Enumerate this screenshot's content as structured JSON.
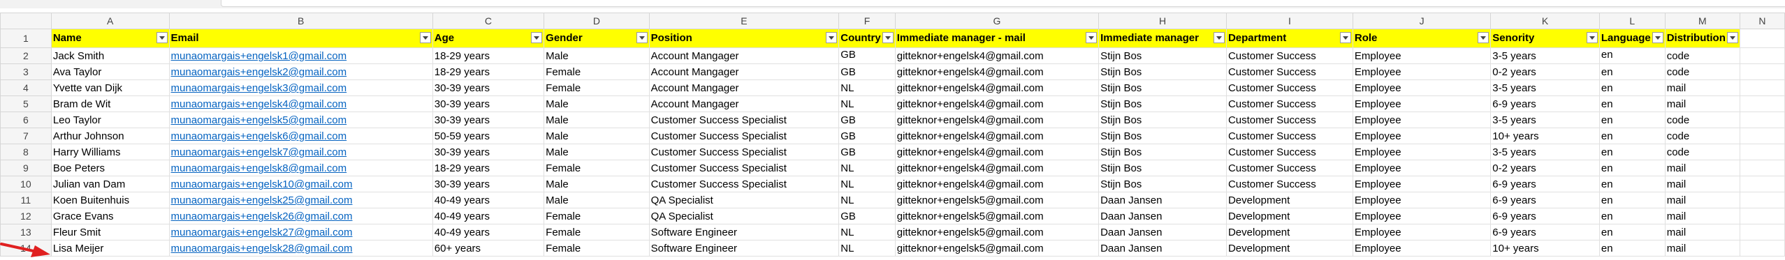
{
  "columns": [
    "A",
    "B",
    "C",
    "D",
    "E",
    "F",
    "G",
    "H",
    "I",
    "J",
    "K",
    "L",
    "M",
    "N"
  ],
  "headers": [
    "Name",
    "Email",
    "Age",
    "Gender",
    "Position",
    "Country",
    "Immediate manager - mail",
    "Immediate manager",
    "Department",
    "Role",
    "Senority",
    "Language",
    "Distribution",
    ""
  ],
  "rows": [
    {
      "num": "2",
      "name": "Jack Smith",
      "email": "munaomargais+engelsk1@gmail.com",
      "age": "18-29 years",
      "gender": "Male",
      "position": "Account Mangager",
      "country": "GB",
      "mgr_mail": "gitteknor+engelsk4@gmail.com",
      "mgr": "Stijn Bos",
      "dept": "Customer Success",
      "role": "Employee",
      "seniority": "3-5 years",
      "lang": "en",
      "dist": "code"
    },
    {
      "num": "3",
      "name": "Ava Taylor",
      "email": "munaomargais+engelsk2@gmail.com",
      "age": "18-29 years",
      "gender": "Female",
      "position": "Account Mangager",
      "country": "GB",
      "mgr_mail": "gitteknor+engelsk4@gmail.com",
      "mgr": "Stijn Bos",
      "dept": "Customer Success",
      "role": "Employee",
      "seniority": "0-2 years",
      "lang": "en",
      "dist": "code"
    },
    {
      "num": "4",
      "name": "Yvette van Dijk",
      "email": "munaomargais+engelsk3@gmail.com",
      "age": "30-39 years",
      "gender": "Female",
      "position": "Account Mangager",
      "country": "NL",
      "mgr_mail": "gitteknor+engelsk4@gmail.com",
      "mgr": "Stijn Bos",
      "dept": "Customer Success",
      "role": "Employee",
      "seniority": "3-5 years",
      "lang": "en",
      "dist": "mail"
    },
    {
      "num": "5",
      "name": "Bram de Wit",
      "email": "munaomargais+engelsk4@gmail.com",
      "age": "30-39 years",
      "gender": "Male",
      "position": "Account Mangager",
      "country": "NL",
      "mgr_mail": "gitteknor+engelsk4@gmail.com",
      "mgr": "Stijn Bos",
      "dept": "Customer Success",
      "role": "Employee",
      "seniority": "6-9 years",
      "lang": "en",
      "dist": "mail"
    },
    {
      "num": "6",
      "name": "Leo Taylor",
      "email": "munaomargais+engelsk5@gmail.com",
      "age": "30-39 years",
      "gender": "Male",
      "position": "Customer Success Specialist",
      "country": "GB",
      "mgr_mail": "gitteknor+engelsk4@gmail.com",
      "mgr": "Stijn Bos",
      "dept": "Customer Success",
      "role": "Employee",
      "seniority": "3-5 years",
      "lang": "en",
      "dist": "code"
    },
    {
      "num": "7",
      "name": "Arthur Johnson",
      "email": "munaomargais+engelsk6@gmail.com",
      "age": "50-59 years",
      "gender": "Male",
      "position": "Customer Success Specialist",
      "country": "GB",
      "mgr_mail": "gitteknor+engelsk4@gmail.com",
      "mgr": "Stijn Bos",
      "dept": "Customer Success",
      "role": "Employee",
      "seniority": "10+ years",
      "lang": "en",
      "dist": "code"
    },
    {
      "num": "8",
      "name": "Harry Williams",
      "email": "munaomargais+engelsk7@gmail.com",
      "age": "30-39 years",
      "gender": "Male",
      "position": "Customer Success Specialist",
      "country": "GB",
      "mgr_mail": "gitteknor+engelsk4@gmail.com",
      "mgr": "Stijn Bos",
      "dept": "Customer Success",
      "role": "Employee",
      "seniority": "3-5 years",
      "lang": "en",
      "dist": "code"
    },
    {
      "num": "9",
      "name": "Boe Peters",
      "email": "munaomargais+engelsk8@gmail.com",
      "age": "18-29 years",
      "gender": "Female",
      "position": "Customer Success Specialist",
      "country": "NL",
      "mgr_mail": "gitteknor+engelsk4@gmail.com",
      "mgr": "Stijn Bos",
      "dept": "Customer Success",
      "role": "Employee",
      "seniority": "0-2 years",
      "lang": "en",
      "dist": "mail"
    },
    {
      "num": "10",
      "name": "Julian van Dam",
      "email": "munaomargais+engelsk10@gmail.com",
      "age": "30-39 years",
      "gender": "Male",
      "position": "Customer Success Specialist",
      "country": "NL",
      "mgr_mail": "gitteknor+engelsk4@gmail.com",
      "mgr": "Stijn Bos",
      "dept": "Customer Success",
      "role": "Employee",
      "seniority": "6-9 years",
      "lang": "en",
      "dist": "mail"
    },
    {
      "num": "11",
      "name": "Koen Buitenhuis",
      "email": "munaomargais+engelsk25@gmail.com",
      "age": "40-49 years",
      "gender": "Male",
      "position": "QA Specialist",
      "country": "NL",
      "mgr_mail": "gitteknor+engelsk5@gmail.com",
      "mgr": "Daan Jansen",
      "dept": "Development",
      "role": "Employee",
      "seniority": "6-9 years",
      "lang": "en",
      "dist": "mail"
    },
    {
      "num": "12",
      "name": "Grace Evans",
      "email": "munaomargais+engelsk26@gmail.com",
      "age": "40-49 years",
      "gender": "Female",
      "position": "QA Specialist",
      "country": "GB",
      "mgr_mail": "gitteknor+engelsk5@gmail.com",
      "mgr": "Daan Jansen",
      "dept": "Development",
      "role": "Employee",
      "seniority": "6-9 years",
      "lang": "en",
      "dist": "mail"
    },
    {
      "num": "13",
      "name": "Fleur Smit",
      "email": "munaomargais+engelsk27@gmail.com",
      "age": "40-49 years",
      "gender": "Female",
      "position": "Software Engineer",
      "country": "NL",
      "mgr_mail": "gitteknor+engelsk5@gmail.com",
      "mgr": "Daan Jansen",
      "dept": "Development",
      "role": "Employee",
      "seniority": "6-9 years",
      "lang": "en",
      "dist": "mail"
    },
    {
      "num": "14",
      "name": "Lisa Meijer",
      "email": "munaomargais+engelsk28@gmail.com",
      "age": "60+ years",
      "gender": "Female",
      "position": "Software Engineer",
      "country": "NL",
      "mgr_mail": "gitteknor+engelsk5@gmail.com",
      "mgr": "Daan Jansen",
      "dept": "Development",
      "role": "Employee",
      "seniority": "10+ years",
      "lang": "en",
      "dist": "mail"
    }
  ],
  "colors": {
    "header_fill": "#ffff00",
    "link": "#0563c1",
    "arrow": "#e02020"
  }
}
